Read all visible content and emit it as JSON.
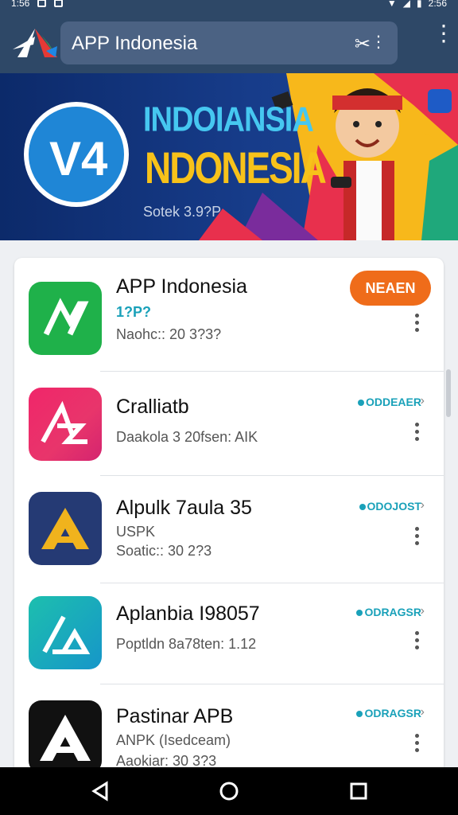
{
  "status_bar": {
    "left": "1:56",
    "right": "2:56"
  },
  "app_bar": {
    "search_text": "APP Indonesia",
    "tool_icon": "scissors-icon",
    "menu_icon": "more-vert-icon"
  },
  "banner": {
    "title_line1": "INDOIANSIA",
    "title_line2": "NDONESIA",
    "subtitle": "Sotek 3.9?P"
  },
  "apps": [
    {
      "name": "APP Indonesia",
      "line1": "1?P?",
      "line2": "Naohc:: 20 3?3?",
      "action": "NEAEN",
      "icon_color": "#1fb14a"
    },
    {
      "name": "Cralliatb",
      "line1": "",
      "line2": "Daakola 3 20fsen: AIK",
      "tag": "ODDEAER",
      "icon_color": "#ec2c63"
    },
    {
      "name": "Alpulk 7aula 35",
      "line1": "USPK",
      "line2": "Soatic:: 30 2?3",
      "tag": "ODOJOST",
      "icon_color": "#253a74"
    },
    {
      "name": "Aplanbia I98057",
      "line1": "",
      "line2": "Poptldn 8a78ten: 1.12",
      "tag": "ODRAGSR",
      "icon_color": "#16a9b7"
    },
    {
      "name": "Pastinar APB",
      "line1": "ANPK  (Isedceam)",
      "line2": "Aaokiar: 30 3?3",
      "tag": "ODRAGSR",
      "icon_color": "#111111"
    }
  ],
  "colors": {
    "app_bar": "#2e4867",
    "accent": "#ef6c1a",
    "tag": "#1aa1b9"
  },
  "nav_bar": {
    "back": "back-icon",
    "home": "home-icon",
    "recents": "recents-icon"
  }
}
